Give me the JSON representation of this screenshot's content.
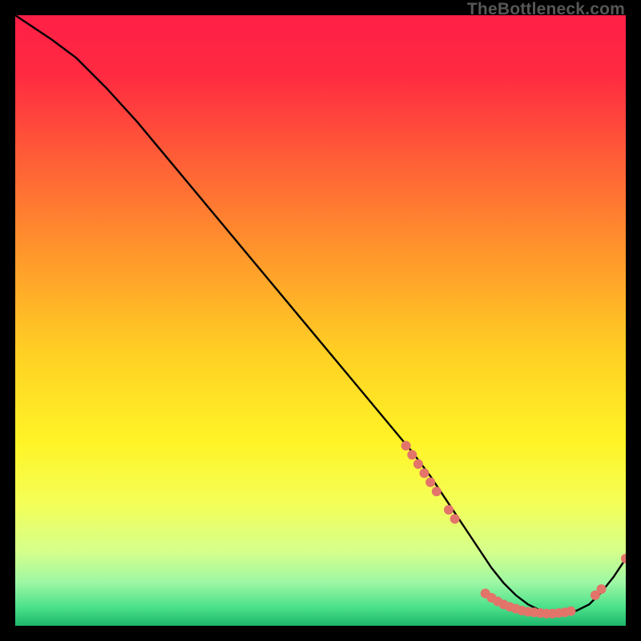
{
  "watermark": "TheBottleneck.com",
  "chart_data": {
    "type": "line",
    "title": "",
    "xlabel": "",
    "ylabel": "",
    "xlim": [
      0,
      100
    ],
    "ylim": [
      0,
      100
    ],
    "background_gradient": {
      "stops": [
        {
          "offset": 0.0,
          "color": "#ff1f47"
        },
        {
          "offset": 0.1,
          "color": "#ff2b41"
        },
        {
          "offset": 0.25,
          "color": "#ff6336"
        },
        {
          "offset": 0.4,
          "color": "#ff9a2b"
        },
        {
          "offset": 0.55,
          "color": "#ffcf24"
        },
        {
          "offset": 0.7,
          "color": "#fff426"
        },
        {
          "offset": 0.8,
          "color": "#f4ff58"
        },
        {
          "offset": 0.88,
          "color": "#d4ff8c"
        },
        {
          "offset": 0.93,
          "color": "#9cf7a4"
        },
        {
          "offset": 0.97,
          "color": "#4ae08a"
        },
        {
          "offset": 1.0,
          "color": "#1db66b"
        }
      ]
    },
    "series": [
      {
        "name": "bottleneck-curve",
        "color": "#000000",
        "x": [
          0,
          3,
          6,
          10,
          15,
          20,
          25,
          30,
          35,
          40,
          45,
          50,
          55,
          60,
          65,
          68,
          70,
          72,
          74,
          76,
          78,
          80,
          82,
          84,
          86,
          88,
          90,
          92,
          94,
          96,
          98,
          100
        ],
        "y": [
          100,
          98,
          96,
          93,
          88,
          82.5,
          76.5,
          70.5,
          64.5,
          58.5,
          52.5,
          46.5,
          40.5,
          34.5,
          28.5,
          24.5,
          21.5,
          18.5,
          15.5,
          12.5,
          9.5,
          7.0,
          5.0,
          3.5,
          2.5,
          2.0,
          2.0,
          2.5,
          3.5,
          5.5,
          8.0,
          11.0
        ]
      }
    ],
    "markers": {
      "color": "#e2746a",
      "radius": 6,
      "points": [
        {
          "x": 64,
          "y": 29.5
        },
        {
          "x": 65,
          "y": 28.0
        },
        {
          "x": 66,
          "y": 26.5
        },
        {
          "x": 67,
          "y": 25.0
        },
        {
          "x": 68,
          "y": 23.5
        },
        {
          "x": 69,
          "y": 22.0
        },
        {
          "x": 71,
          "y": 19.0
        },
        {
          "x": 72,
          "y": 17.5
        },
        {
          "x": 77,
          "y": 5.3
        },
        {
          "x": 78,
          "y": 4.6
        },
        {
          "x": 79,
          "y": 4.0
        },
        {
          "x": 80,
          "y": 3.5
        },
        {
          "x": 81,
          "y": 3.1
        },
        {
          "x": 82,
          "y": 2.8
        },
        {
          "x": 83,
          "y": 2.5
        },
        {
          "x": 84,
          "y": 2.3
        },
        {
          "x": 85,
          "y": 2.2
        },
        {
          "x": 86,
          "y": 2.1
        },
        {
          "x": 87,
          "y": 2.0
        },
        {
          "x": 88,
          "y": 2.0
        },
        {
          "x": 89,
          "y": 2.1
        },
        {
          "x": 90,
          "y": 2.2
        },
        {
          "x": 91,
          "y": 2.4
        },
        {
          "x": 95,
          "y": 5.0
        },
        {
          "x": 96,
          "y": 6.0
        },
        {
          "x": 100,
          "y": 11.0
        }
      ]
    }
  }
}
